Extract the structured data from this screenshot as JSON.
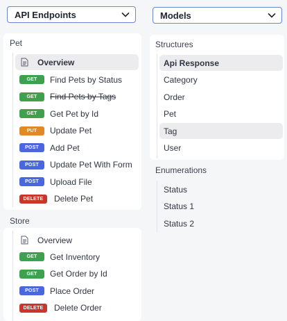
{
  "left_select": {
    "value": "API Endpoints"
  },
  "right_select": {
    "value": "Models"
  },
  "pet": {
    "title": "Pet",
    "overview": "Overview",
    "items": [
      {
        "method": "GET",
        "label": "Find Pets by Status",
        "color": "#3fa14f",
        "deprecated": false
      },
      {
        "method": "GET",
        "label": "Find Pets by Tags",
        "color": "#3fa14f",
        "deprecated": true
      },
      {
        "method": "GET",
        "label": "Get Pet by Id",
        "color": "#3fa14f",
        "deprecated": false
      },
      {
        "method": "PUT",
        "label": "Update Pet",
        "color": "#e0892a",
        "deprecated": false
      },
      {
        "method": "POST",
        "label": "Add Pet",
        "color": "#4a67e0",
        "deprecated": false
      },
      {
        "method": "POST",
        "label": "Update Pet With Form",
        "color": "#4a67e0",
        "deprecated": false
      },
      {
        "method": "POST",
        "label": "Upload File",
        "color": "#4a67e0",
        "deprecated": false
      },
      {
        "method": "DELETE",
        "label": "Delete Pet",
        "color": "#c8372d",
        "deprecated": false
      }
    ]
  },
  "store": {
    "title": "Store",
    "overview": "Overview",
    "items": [
      {
        "method": "GET",
        "label": "Get Inventory",
        "color": "#3fa14f"
      },
      {
        "method": "GET",
        "label": "Get Order by Id",
        "color": "#3fa14f"
      },
      {
        "method": "POST",
        "label": "Place Order",
        "color": "#4a67e0"
      },
      {
        "method": "DELETE",
        "label": "Delete Order",
        "color": "#c8372d"
      }
    ]
  },
  "structures": {
    "title": "Structures",
    "items": [
      "Api Response",
      "Category",
      "Order",
      "Pet",
      "Tag",
      "User"
    ]
  },
  "enumerations": {
    "title": "Enumerations",
    "items": [
      "Status",
      "Status 1",
      "Status 2"
    ]
  }
}
